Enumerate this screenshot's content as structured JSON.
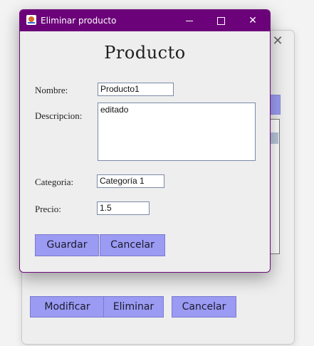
{
  "background_window": {
    "buttons": {
      "modify": "Modificar",
      "delete": "Eliminar",
      "cancel": "Cancelar"
    }
  },
  "dialog": {
    "title": "Eliminar producto",
    "heading": "Producto",
    "fields": {
      "name_label": "Nombre:",
      "name_value": "Producto1",
      "description_label": "Descripcion:",
      "description_value": "editado",
      "category_label": "Categoria:",
      "category_value": "Categoría 1",
      "price_label": "Precio:",
      "price_value": "1.5"
    },
    "buttons": {
      "save": "Guardar",
      "cancel": "Cancelar"
    }
  },
  "colors": {
    "titlebar": "#6b0279",
    "button": "#9b9bf3"
  }
}
